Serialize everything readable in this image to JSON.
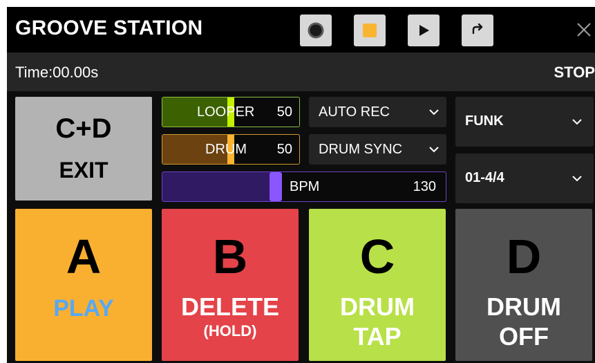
{
  "header": {
    "title": "GROOVE STATION",
    "transport": [
      {
        "name": "record",
        "icon": "record-circle-icon"
      },
      {
        "name": "stop",
        "icon": "stop-square-icon",
        "accent": "#f9b531"
      },
      {
        "name": "play",
        "icon": "play-triangle-icon"
      },
      {
        "name": "loop",
        "icon": "loop-arrow-icon"
      }
    ],
    "close_icon": "close-icon"
  },
  "status": {
    "time": "Time:00.00s",
    "state": "STOP"
  },
  "exit_button": {
    "top": "C+D",
    "bottom": "EXIT"
  },
  "levels": {
    "looper": {
      "label": "LOOPER",
      "value": "50",
      "level": 0.5,
      "color": "#c6f000"
    },
    "drum": {
      "label": "DRUM",
      "value": "50",
      "level": 0.5,
      "color": "#f9b531"
    },
    "bpm": {
      "label": "BPM",
      "value": "130",
      "level": 0.4,
      "color": "#8a56ff"
    }
  },
  "dropdowns": {
    "auto_rec": "AUTO REC",
    "drum_sync": "DRUM SYNC",
    "style": "FUNK",
    "pattern": "01-4/4",
    "chevron_icon": "chevron-down-icon"
  },
  "pads": {
    "a": {
      "letter": "A",
      "text": "PLAY",
      "color": "#f9b031",
      "text_color": "#58a8f3"
    },
    "b": {
      "letter": "B",
      "text": "DELETE",
      "sub": "(HOLD)",
      "color": "#e34349"
    },
    "c": {
      "letter": "C",
      "line1": "DRUM",
      "line2": "TAP",
      "color": "#b8e048"
    },
    "d": {
      "letter": "D",
      "line1": "DRUM",
      "line2": "OFF",
      "color": "#505050"
    }
  }
}
